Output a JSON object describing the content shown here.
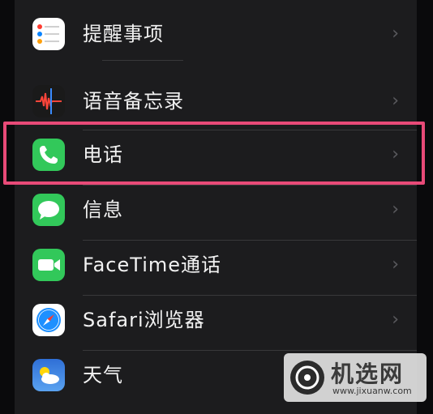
{
  "settings": {
    "items": [
      {
        "label": "提醒事项",
        "icon": "reminders-icon"
      },
      {
        "label": "语音备忘录",
        "icon": "voice-memos-icon"
      },
      {
        "label": "电话",
        "icon": "phone-icon"
      },
      {
        "label": "信息",
        "icon": "messages-icon"
      },
      {
        "label": "FaceTime通话",
        "icon": "facetime-icon"
      },
      {
        "label": "Safari浏览器",
        "icon": "safari-icon"
      },
      {
        "label": "天气",
        "icon": "weather-icon"
      }
    ],
    "chevron": "›"
  },
  "highlight_color": "#e84a78",
  "watermark": {
    "title": "机选网",
    "subtitle": "www.jixuanw.com"
  }
}
